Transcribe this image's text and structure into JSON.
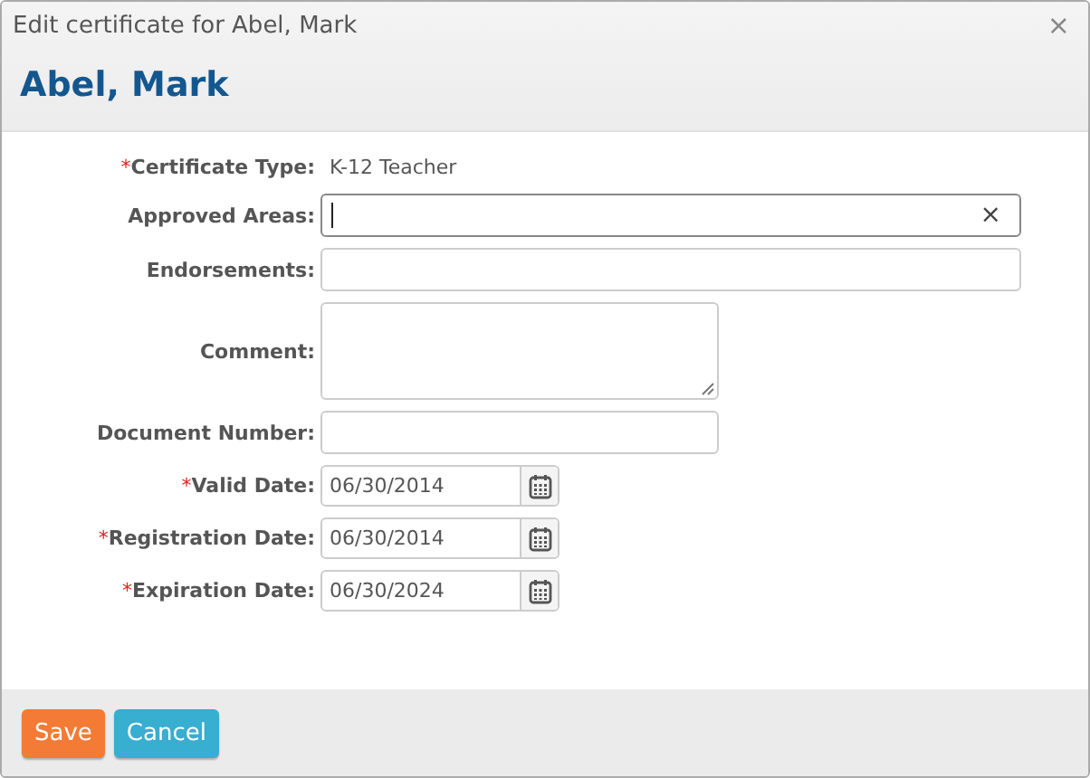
{
  "window": {
    "title": "Edit certificate for Abel, Mark",
    "close": "×"
  },
  "heading": "Abel, Mark",
  "fields": [
    {
      "kind": "static",
      "marker": "*",
      "label": "Certificate Type:",
      "value": "K-12 Teacher"
    },
    {
      "kind": "text",
      "label": "Approved Areas:",
      "focused": true,
      "clear": "×"
    },
    {
      "kind": "text",
      "label": "Endorsements:",
      "focused": false
    },
    {
      "kind": "textarea",
      "label": "Comment:"
    },
    {
      "kind": "short",
      "label": "Document Number:"
    },
    {
      "kind": "date",
      "marker": "*",
      "label": "Valid Date:",
      "value": "06/30/2014"
    },
    {
      "kind": "date",
      "marker": "*",
      "label": "Registration Date:",
      "value": "06/30/2014"
    },
    {
      "kind": "date",
      "marker": "*",
      "label": "Expiration Date:",
      "value": "06/30/2024"
    }
  ],
  "buttons": [
    {
      "label": "Save",
      "kind": "primary"
    },
    {
      "label": "Cancel",
      "kind": "secondary"
    }
  ]
}
